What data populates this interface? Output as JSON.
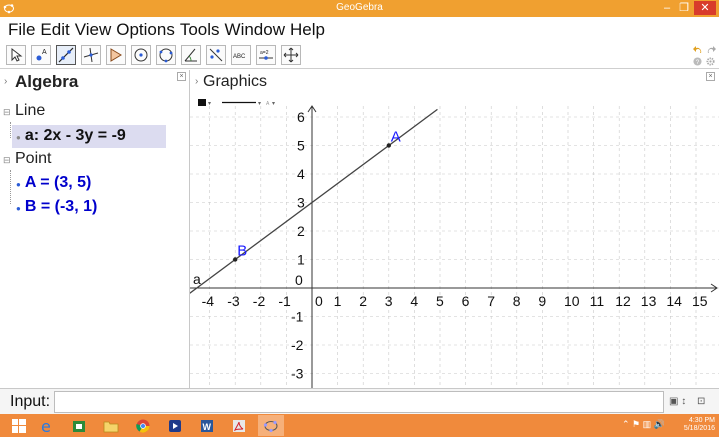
{
  "window": {
    "title": "GeoGebra",
    "minimize": "–",
    "maximize": "❐",
    "close": "✕"
  },
  "menu": [
    "File",
    "Edit",
    "View",
    "Options",
    "Tools",
    "Window",
    "Help"
  ],
  "toolbar": {
    "tools": [
      "move-tool",
      "point-tool",
      "line-tool",
      "perpendicular-tool",
      "polygon-tool",
      "circle-tool",
      "conic-tool",
      "angle-tool",
      "reflect-tool",
      "text-tool",
      "slider-tool",
      "move-view-tool"
    ],
    "text_tool_label": "ABC",
    "slider_tool_label": "a=2",
    "active_index": 2
  },
  "algebra": {
    "title": "Algebra",
    "categories": [
      {
        "label": "Line",
        "items": [
          "a: 2x - 3y = -9"
        ]
      },
      {
        "label": "Point",
        "items": [
          "A = (3, 5)",
          "B = (-3, 1)"
        ]
      }
    ]
  },
  "graphics": {
    "title": "Graphics",
    "x_ticks": [
      "-4",
      "-3",
      "-2",
      "-1",
      "0",
      "1",
      "2",
      "3",
      "4",
      "5",
      "6",
      "7",
      "8",
      "9",
      "10",
      "11",
      "12",
      "13",
      "14",
      "15"
    ],
    "y_ticks": [
      "6",
      "5",
      "4",
      "3",
      "2",
      "1",
      "0",
      "-1",
      "-2",
      "-3"
    ],
    "line_label": "a",
    "points": [
      {
        "name": "A",
        "x": 3,
        "y": 5
      },
      {
        "name": "B",
        "x": -3,
        "y": 1
      }
    ],
    "line_color": "#444444",
    "point_label_color": "#1a1aff"
  },
  "input": {
    "label": "Input:"
  },
  "taskbar": {
    "time": "4:30 PM",
    "date": "5/18/2016"
  },
  "colors": {
    "titlebar": "#f0a030",
    "taskbar": "#f08a3c",
    "object_blue": "#0000cc"
  }
}
